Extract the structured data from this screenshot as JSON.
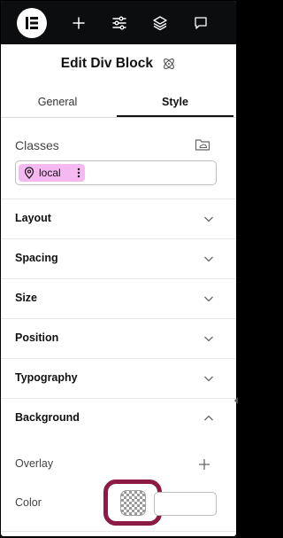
{
  "toolbar": {
    "items": [
      {
        "icon": "elementor-logo-icon"
      },
      {
        "icon": "plus-icon"
      },
      {
        "icon": "sliders-icon"
      },
      {
        "icon": "layers-icon"
      },
      {
        "icon": "chat-icon"
      }
    ]
  },
  "header": {
    "title": "Edit Div Block",
    "icon": "atom-icon"
  },
  "tabs": [
    {
      "label": "General",
      "active": false
    },
    {
      "label": "Style",
      "active": true
    }
  ],
  "classes": {
    "label": "Classes",
    "chip_label": "local",
    "chip_color": "#f5b8f1"
  },
  "sections": [
    {
      "label": "Layout",
      "expanded": false
    },
    {
      "label": "Spacing",
      "expanded": false
    },
    {
      "label": "Size",
      "expanded": false
    },
    {
      "label": "Position",
      "expanded": false
    },
    {
      "label": "Typography",
      "expanded": false
    },
    {
      "label": "Background",
      "expanded": true
    }
  ],
  "background": {
    "overlay_label": "Overlay",
    "color_label": "Color",
    "color_value": ""
  },
  "highlight_color": "#8b1a45"
}
